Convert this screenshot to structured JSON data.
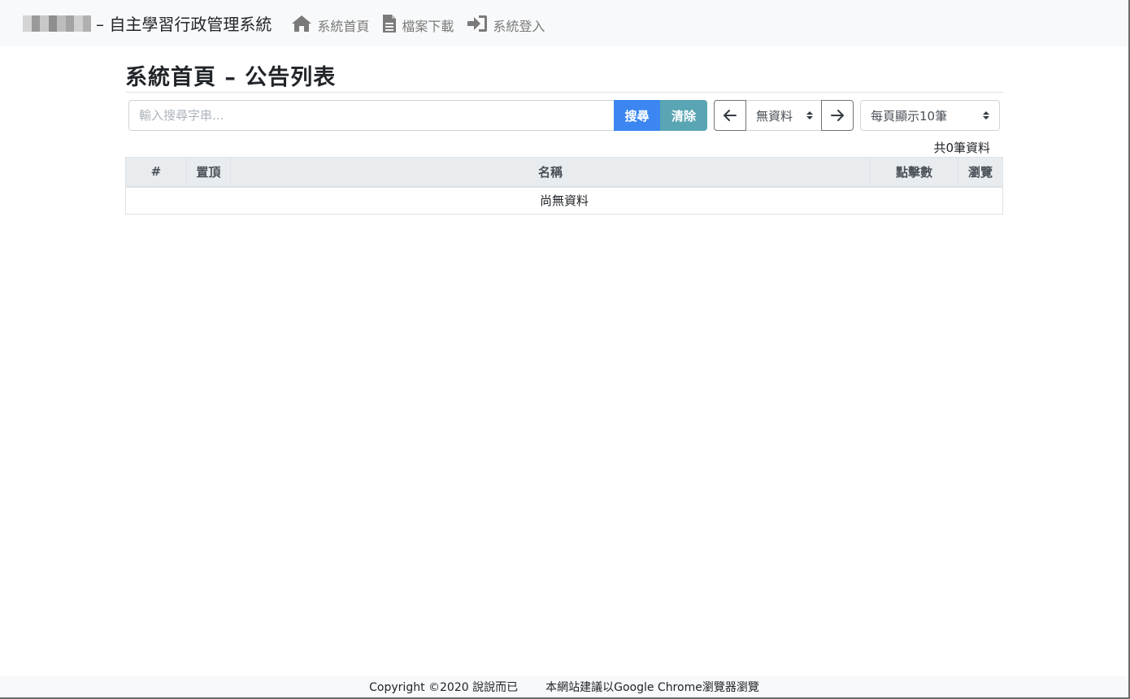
{
  "navbar": {
    "brand_suffix": "– 自主學習行政管理系統",
    "items": [
      {
        "label": "系統首頁",
        "icon": "home-icon"
      },
      {
        "label": "檔案下載",
        "icon": "file-icon"
      },
      {
        "label": "系統登入",
        "icon": "sign-in-icon"
      }
    ]
  },
  "page": {
    "title": "系統首頁 – 公告列表"
  },
  "toolbar": {
    "search_placeholder": "輸入搜尋字串...",
    "search_label": "搜尋",
    "clear_label": "清除",
    "page_select_value": "無資料",
    "per_page_value": "每頁顯示10筆"
  },
  "table": {
    "total_text": "共0筆資料",
    "columns": [
      "#",
      "置頂",
      "名稱",
      "點擊數",
      "瀏覽"
    ],
    "empty_text": "尚無資料"
  },
  "footer": {
    "copyright": "Copyright ©2020 說說而已",
    "notice": "本網站建議以Google Chrome瀏覽器瀏覽"
  },
  "colors": {
    "search_button": "#3b86f0",
    "clear_button": "#5aa5b3",
    "navbar_bg": "#f8f9fa"
  }
}
